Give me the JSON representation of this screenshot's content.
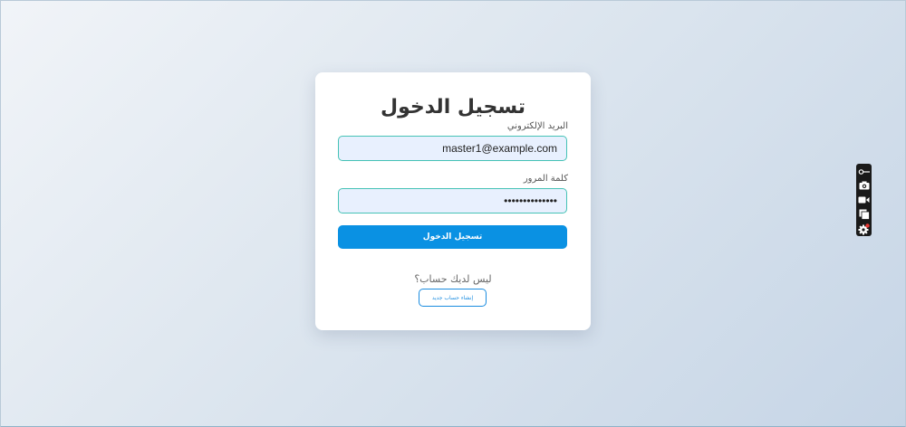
{
  "login": {
    "title": "تسجيل الدخول",
    "email_label": "البريد الإلكتروني",
    "email_value": "master1@example.com",
    "password_label": "كلمة المرور",
    "password_value": "••••••••••••••",
    "submit_label": "تسجيل الدخول",
    "signup_prompt": "ليس لديك حساب؟",
    "signup_button": "إنشاء حساب جديد"
  },
  "toolbar": {
    "icons": [
      "pin-icon",
      "camera-icon",
      "video-icon",
      "copy-icon",
      "gear-icon"
    ]
  },
  "colors": {
    "primary": "#0a91e3",
    "input_border": "#45c2b6",
    "input_bg": "#e8f0fe",
    "badge": "#e53935"
  }
}
